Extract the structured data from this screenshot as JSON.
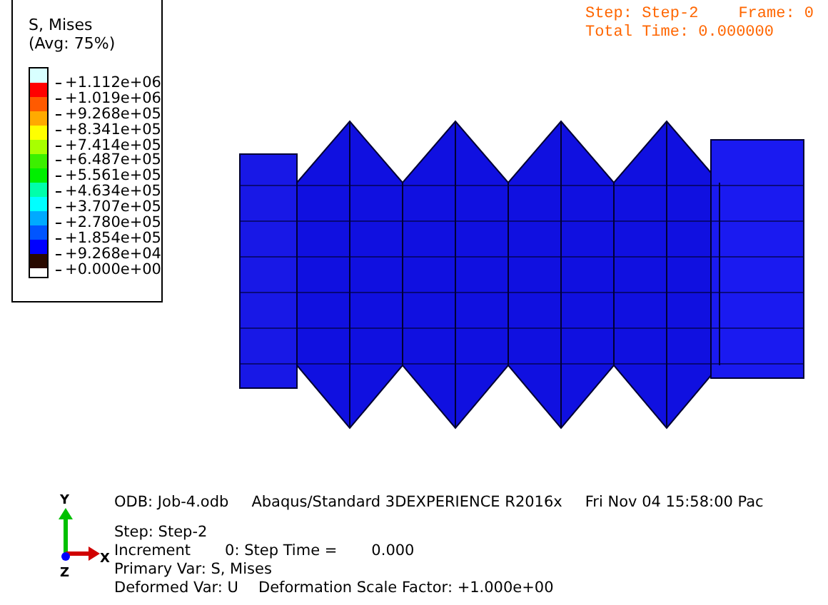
{
  "legend": {
    "title": "S, Mises",
    "subtitle": "(Avg: 75%)",
    "bands": [
      {
        "color": "#d8ffff"
      },
      {
        "color": "#ff0000"
      },
      {
        "color": "#ff5a00"
      },
      {
        "color": "#ffaa00"
      },
      {
        "color": "#ffff00"
      },
      {
        "color": "#a8ff00"
      },
      {
        "color": "#3cf000"
      },
      {
        "color": "#00f000"
      },
      {
        "color": "#00ffaa"
      },
      {
        "color": "#00ffff"
      },
      {
        "color": "#00aaff"
      },
      {
        "color": "#0055ff"
      },
      {
        "color": "#0000ff"
      },
      {
        "color": "#2a0a00"
      }
    ],
    "labels": [
      "+1.112e+06",
      "+1.019e+06",
      "+9.268e+05",
      "+8.341e+05",
      "+7.414e+05",
      "+6.487e+05",
      "+5.561e+05",
      "+4.634e+05",
      "+3.707e+05",
      "+2.780e+05",
      "+1.854e+05",
      "+9.268e+04",
      "+0.000e+00"
    ]
  },
  "step_info": {
    "step": "Step: Step-2",
    "frame": "Frame: 0",
    "total_time": "Total Time: 0.000000"
  },
  "triad": {
    "y": "Y",
    "x": "X",
    "z": "Z"
  },
  "info": {
    "odb": "ODB: Job-4.odb",
    "solver": "Abaqus/Standard 3DEXPERIENCE R2016x",
    "date": "Fri Nov 04 15:58:00 Pac",
    "step": "Step: Step-2",
    "increment": "Increment",
    "increment_value": "0: Step Time =",
    "step_time": "0.000",
    "primary_var": "Primary Var: S, Mises",
    "deformed_var": "Deformed Var: U",
    "scale_factor": "Deformation Scale Factor: +1.000e+00"
  }
}
